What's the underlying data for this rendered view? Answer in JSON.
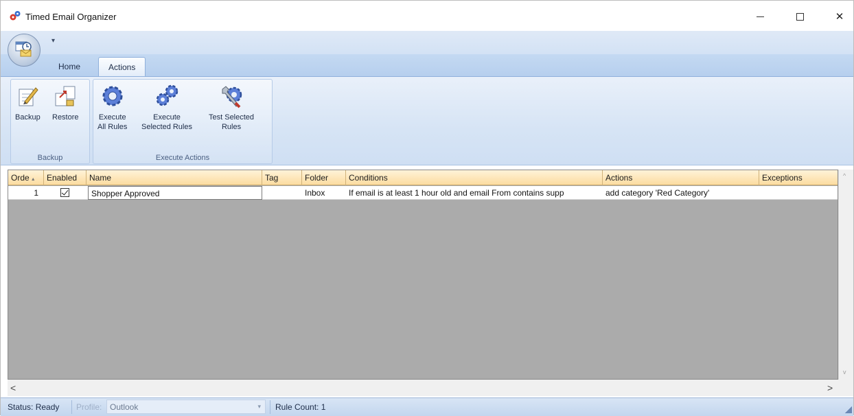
{
  "window": {
    "title": "Timed Email Organizer",
    "minimize_glyph": "–",
    "close_glyph": "✕"
  },
  "qat": {
    "dropdown_glyph": "▾"
  },
  "ribbon": {
    "tabs": [
      {
        "label": "Home",
        "selected": false
      },
      {
        "label": "Actions",
        "selected": true
      }
    ],
    "groups": {
      "backup": {
        "label": "Backup",
        "buttons": {
          "backup": {
            "label": "Backup",
            "icon": "notepad-pencil-icon"
          },
          "restore": {
            "label": "Restore",
            "icon": "restore-pages-icon"
          }
        }
      },
      "execute": {
        "label": "Execute Actions",
        "buttons": {
          "execute_all": {
            "line1": "Execute",
            "line2": "All Rules",
            "icon": "gear-icon"
          },
          "execute_selected": {
            "line1": "Execute",
            "line2": "Selected Rules",
            "icon": "gears-icon"
          },
          "test_selected": {
            "line1": "Test Selected",
            "line2": "Rules",
            "icon": "wrench-gear-icon"
          }
        }
      }
    }
  },
  "grid": {
    "columns": {
      "order": "Orde",
      "enabled": "Enabled",
      "name": "Name",
      "tag": "Tag",
      "folder": "Folder",
      "conditions": "Conditions",
      "actions": "Actions",
      "exceptions": "Exceptions"
    },
    "sort_glyph": "▲",
    "rows": [
      {
        "order": "1",
        "enabled": true,
        "name": "Shopper Approved",
        "tag": "",
        "folder": "Inbox",
        "conditions": "If email is at least 1 hour old and email From contains supp",
        "actions": "add category 'Red Category'",
        "exceptions": ""
      }
    ]
  },
  "scroll": {
    "left_glyph": "<",
    "right_glyph": ">",
    "up_glyph": "^",
    "down_glyph": "v"
  },
  "status": {
    "status_text": "Status: Ready",
    "profile_label": "Profile:",
    "profile_value": "Outlook",
    "profile_dropdown_glyph": "▾",
    "rule_count": "Rule Count: 1"
  },
  "colors": {
    "ribbon_blue": "#d6e4f5",
    "header_orange": "#fcdca0",
    "grid_gray": "#ababab"
  }
}
